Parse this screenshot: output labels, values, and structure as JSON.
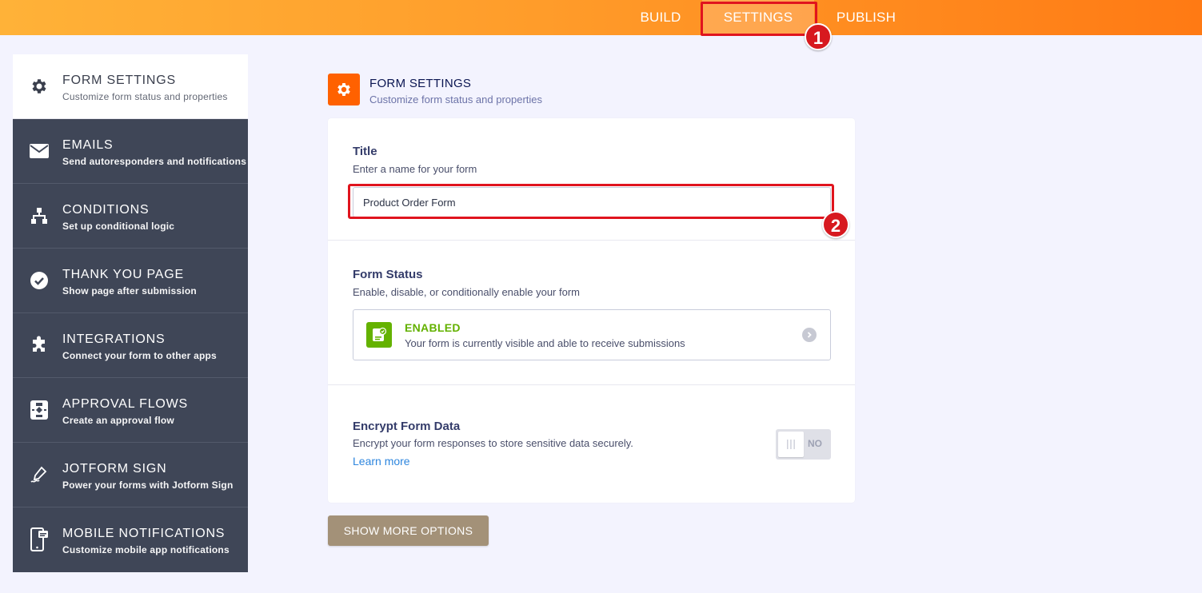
{
  "topbar": {
    "tabs": [
      {
        "label": "BUILD"
      },
      {
        "label": "SETTINGS",
        "active": true
      },
      {
        "label": "PUBLISH"
      }
    ]
  },
  "annotations": {
    "badge1": "1",
    "badge2": "2"
  },
  "sidebar": {
    "items": [
      {
        "title": "FORM SETTINGS",
        "subtitle": "Customize form status and properties",
        "icon": "gear-icon",
        "active": true
      },
      {
        "title": "EMAILS",
        "subtitle": "Send autoresponders and notifications",
        "icon": "envelope-icon"
      },
      {
        "title": "CONDITIONS",
        "subtitle": "Set up conditional logic",
        "icon": "sitemap-icon"
      },
      {
        "title": "THANK YOU PAGE",
        "subtitle": "Show page after submission",
        "icon": "check-circle-icon"
      },
      {
        "title": "INTEGRATIONS",
        "subtitle": "Connect your form to other apps",
        "icon": "puzzle-icon"
      },
      {
        "title": "APPROVAL FLOWS",
        "subtitle": "Create an approval flow",
        "icon": "flowchart-icon"
      },
      {
        "title": "JOTFORM SIGN",
        "subtitle": "Power your forms with Jotform Sign",
        "icon": "pen-sign-icon"
      },
      {
        "title": "MOBILE NOTIFICATIONS",
        "subtitle": "Customize mobile app notifications",
        "icon": "mobile-icon"
      }
    ]
  },
  "main": {
    "header": {
      "title": "FORM SETTINGS",
      "subtitle": "Customize form status and properties",
      "icon": "gear-icon"
    },
    "title_section": {
      "label": "Title",
      "description": "Enter a name for your form",
      "value": "Product Order Form"
    },
    "status_section": {
      "label": "Form Status",
      "description": "Enable, disable, or conditionally enable your form",
      "status_title": "ENABLED",
      "status_desc": "Your form is currently visible and able to receive submissions"
    },
    "encrypt_section": {
      "label": "Encrypt Form Data",
      "description": "Encrypt your form responses to store sensitive data securely.",
      "link": "Learn more",
      "toggle_label": "NO"
    },
    "show_more_label": "SHOW MORE OPTIONS"
  },
  "colors": {
    "accent_orange": "#ff6100",
    "sidebar_bg": "#3f4657",
    "enabled_green": "#64b200",
    "highlight_red": "#e0141e",
    "button_tan": "#a39178"
  }
}
